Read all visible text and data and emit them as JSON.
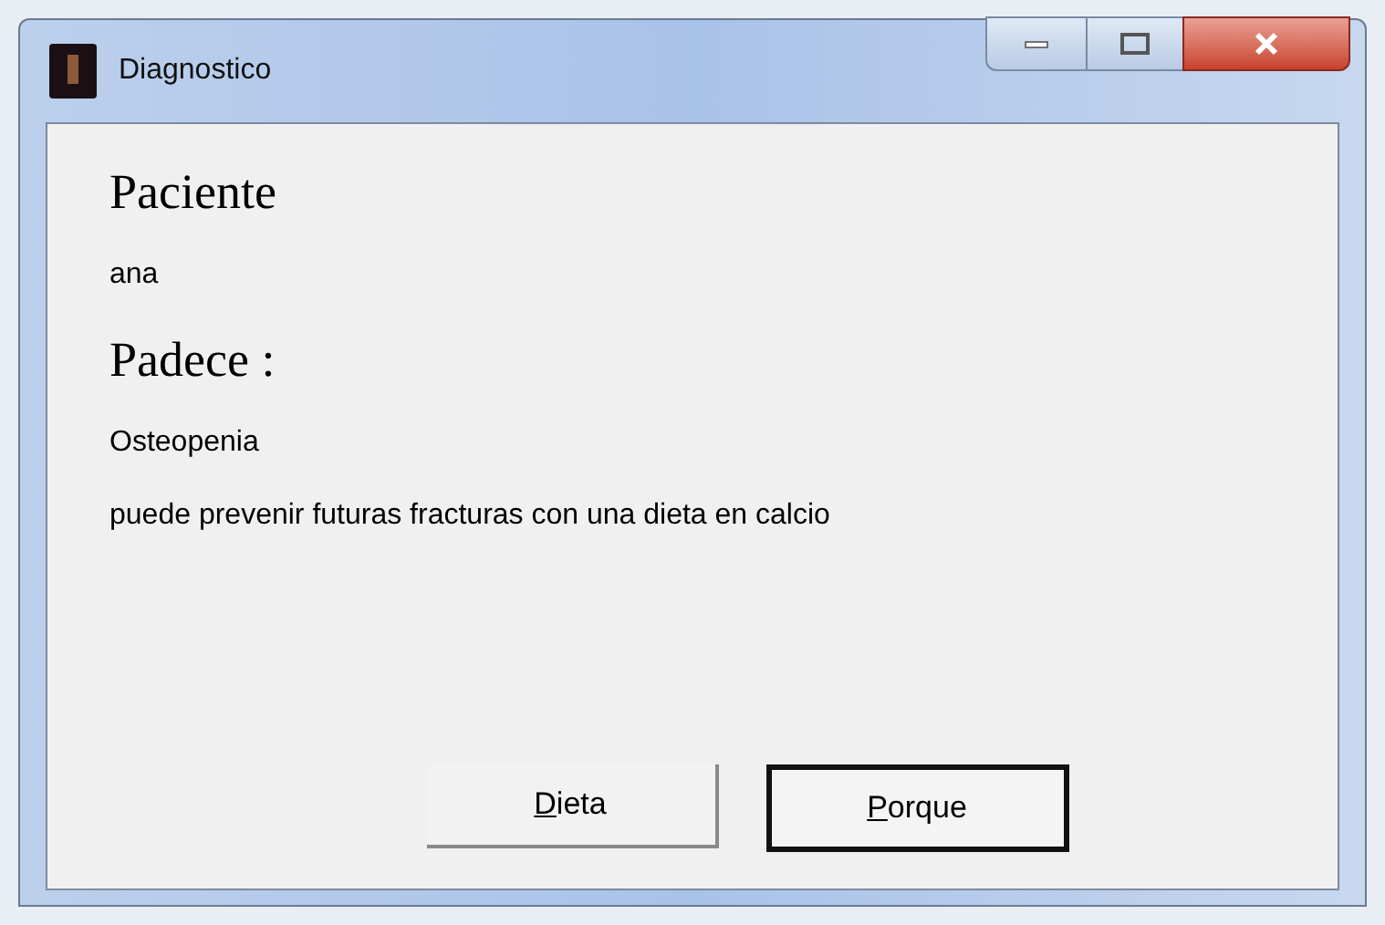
{
  "window": {
    "title": "Diagnostico"
  },
  "labels": [
    {
      "kind": "heading",
      "text": "Paciente"
    },
    {
      "kind": "value",
      "text": "ana"
    },
    {
      "kind": "heading",
      "text": "Padece :"
    },
    {
      "kind": "value",
      "text": "Osteopenia"
    },
    {
      "kind": "value",
      "text": "puede prevenir futuras fracturas con una dieta en calcio"
    }
  ],
  "buttons": [
    {
      "label": "Dieta",
      "focused": false
    },
    {
      "label": "Porque",
      "focused": true
    }
  ]
}
